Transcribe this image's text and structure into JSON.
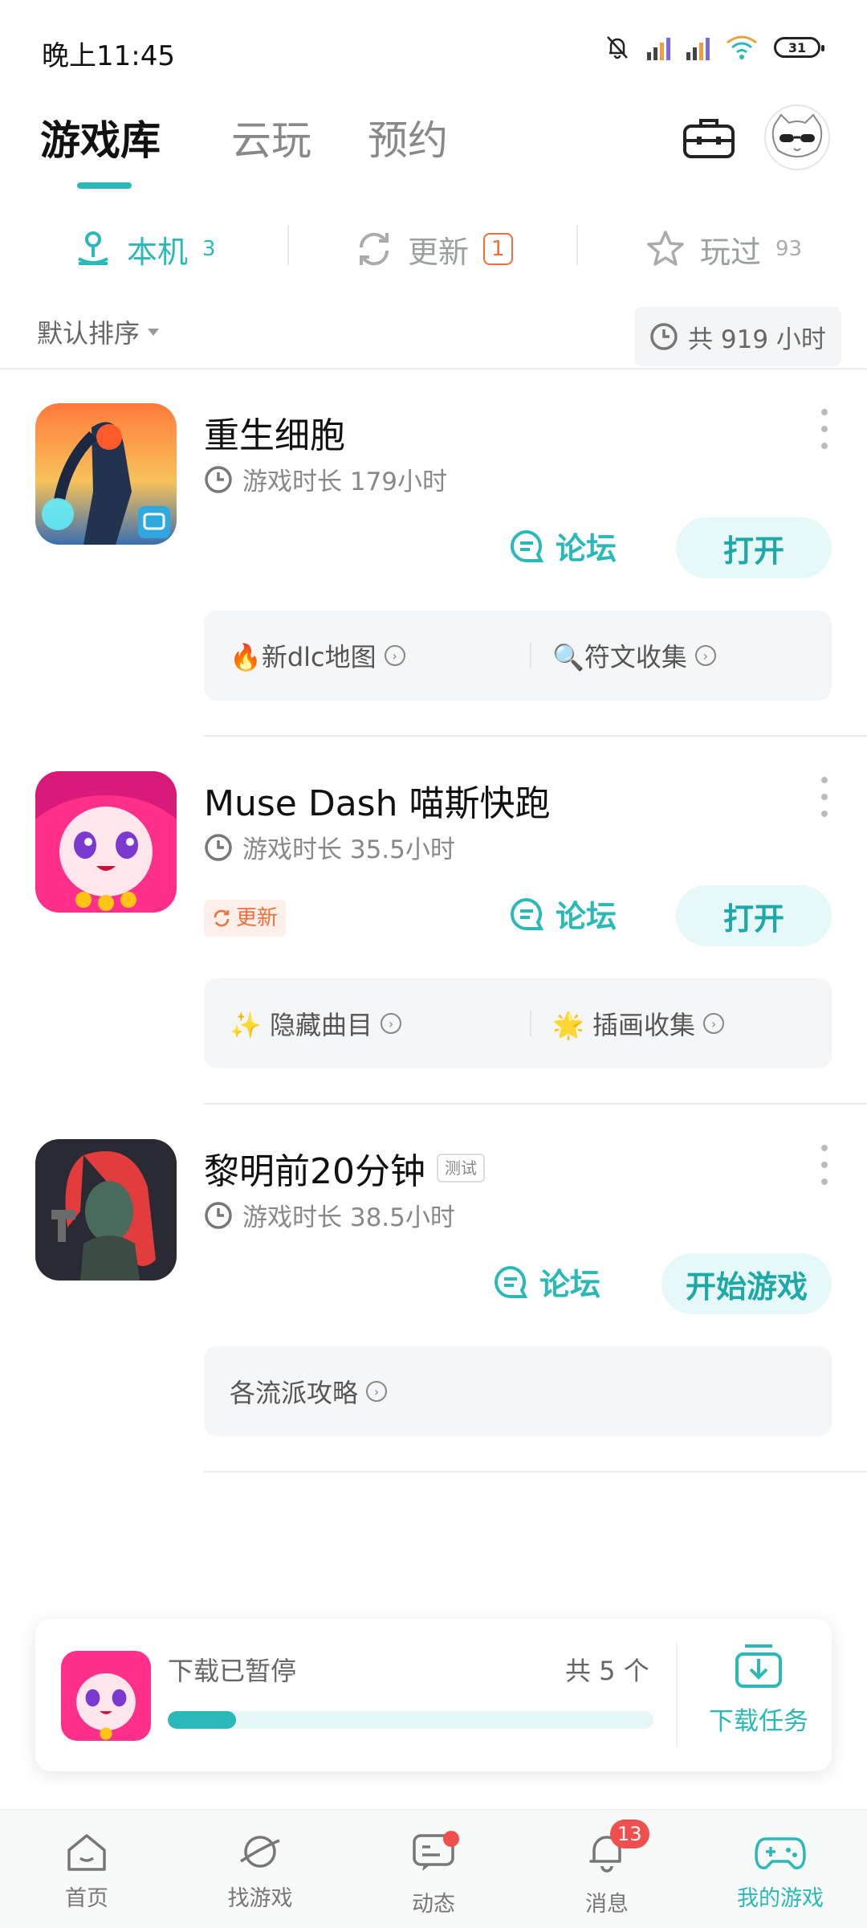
{
  "status_bar": {
    "time": "晚上11:45",
    "battery": "31"
  },
  "header": {
    "tabs": [
      {
        "label": "游戏库",
        "active": true
      },
      {
        "label": "云玩",
        "active": false
      },
      {
        "label": "预约",
        "active": false
      }
    ]
  },
  "subtabs": [
    {
      "label": "本机",
      "count": "3",
      "active": true
    },
    {
      "label": "更新",
      "count": "1",
      "active": false
    },
    {
      "label": "玩过",
      "count": "93",
      "active": false
    }
  ],
  "sort": {
    "label": "默认排序"
  },
  "total_hours": "共 919 小时",
  "games": [
    {
      "name": "重生细胞",
      "playtime": "游戏时长 179小时",
      "forum_label": "论坛",
      "open_label": "打开",
      "chips": [
        "🔥新dlc地图",
        "🔍符文收集"
      ]
    },
    {
      "name": "Muse Dash 喵斯快跑",
      "playtime": "游戏时长 35.5小时",
      "update_tag": "更新",
      "forum_label": "论坛",
      "open_label": "打开",
      "chips": [
        "✨ 隐藏曲目",
        "🌟 插画收集"
      ]
    },
    {
      "name": "黎明前20分钟",
      "tag": "测试",
      "playtime": "游戏时长 38.5小时",
      "forum_label": "论坛",
      "open_label": "开始游戏",
      "chips": [
        "各流派攻略"
      ]
    }
  ],
  "download": {
    "status": "下载已暂停",
    "count": "共 5 个",
    "progress": 0.14,
    "task_label": "下载任务"
  },
  "nav": {
    "items": [
      {
        "label": "首页"
      },
      {
        "label": "找游戏"
      },
      {
        "label": "动态"
      },
      {
        "label": "消息",
        "badge": "13"
      },
      {
        "label": "我的游戏",
        "active": true
      }
    ]
  },
  "colors": {
    "accent": "#2ab8b8",
    "update": "#f06e3c",
    "badge": "#f04f4f"
  }
}
